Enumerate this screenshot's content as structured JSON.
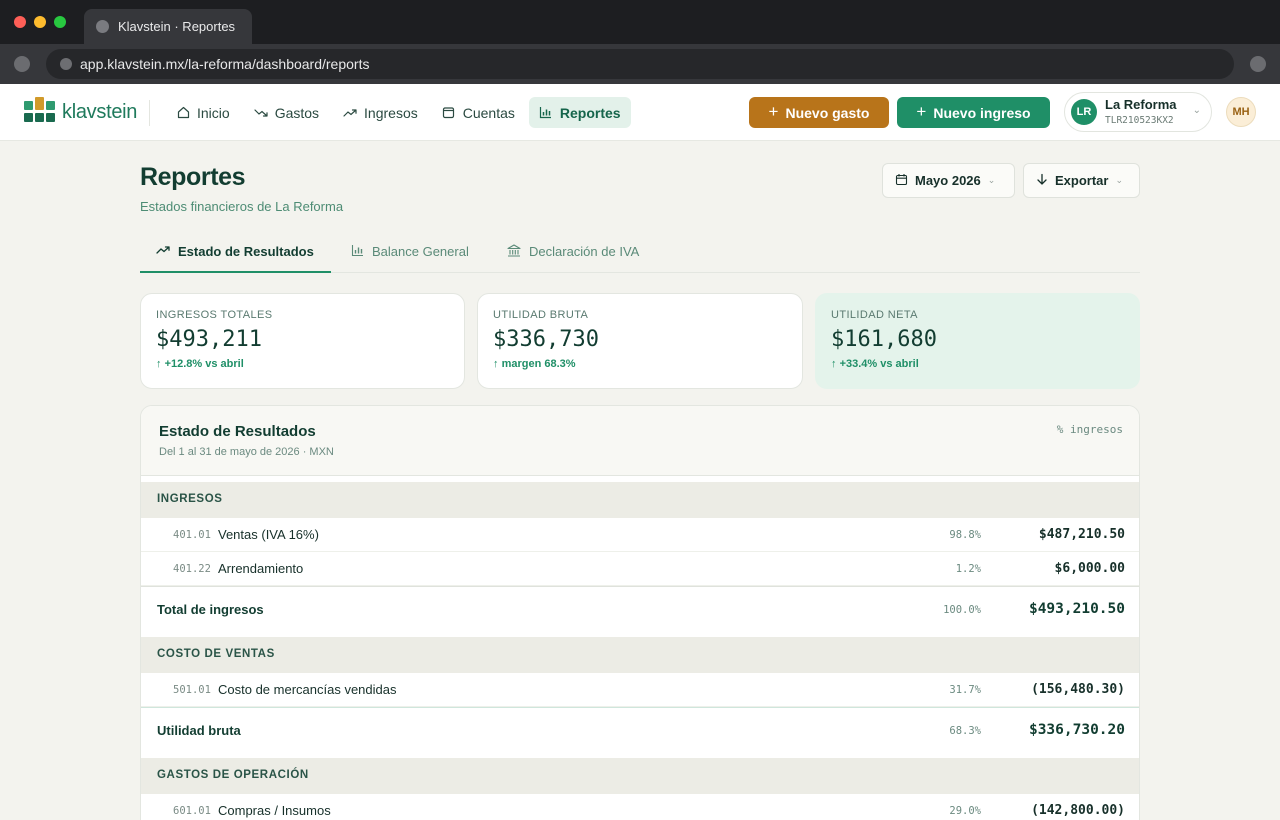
{
  "browser": {
    "tab_title": "Klavstein · Reportes",
    "url": "app.klavstein.mx/la-reforma/dashboard/reports"
  },
  "app": {
    "logo_text": "klavstein",
    "nav": [
      {
        "label": "Inicio",
        "icon": "home-icon"
      },
      {
        "label": "Gastos",
        "icon": "trend-down-icon"
      },
      {
        "label": "Ingresos",
        "icon": "trend-up-icon"
      },
      {
        "label": "Cuentas",
        "icon": "wallet-icon"
      },
      {
        "label": "Reportes",
        "icon": "bar-chart-icon",
        "active": true
      }
    ],
    "new_expense": "Nuevo gasto",
    "new_income": "Nuevo ingreso",
    "org": {
      "initials": "LR",
      "name": "La Reforma",
      "rfc": "TLR210523KX2"
    },
    "user_initials": "MH"
  },
  "page": {
    "title": "Reportes",
    "subtitle": "Estados financieros de La Reforma",
    "period": "Mayo 2026",
    "export": "Exportar"
  },
  "tabs": [
    {
      "label": "Estado de Resultados",
      "active": true
    },
    {
      "label": "Balance General"
    },
    {
      "label": "Declaración de IVA"
    }
  ],
  "kpis": [
    {
      "label": "INGRESOS TOTALES",
      "value": "$493,211",
      "delta": "+12.8% vs abril"
    },
    {
      "label": "UTILIDAD BRUTA",
      "value": "$336,730",
      "delta": "margen 68.3%"
    },
    {
      "label": "UTILIDAD NETA",
      "value": "$161,680",
      "delta": "+33.4% vs abril"
    }
  ],
  "statement": {
    "title": "Estado de Resultados",
    "subtitle": "Del 1 al 31 de mayo de 2026 · MXN",
    "pct_header": "% ingresos",
    "sec_ingresos": "INGRESOS",
    "row_ventas": {
      "code": "401.01",
      "name": "Ventas (IVA 16%)",
      "pct": "98.8%",
      "amount": "$487,210.50"
    },
    "row_arrend": {
      "code": "401.22",
      "name": "Arrendamiento",
      "pct": "1.2%",
      "amount": "$6,000.00"
    },
    "total_ingresos": {
      "label": "Total de ingresos",
      "pct": "100.0%",
      "amount": "$493,210.50"
    },
    "sec_costo": "COSTO DE VENTAS",
    "row_costo": {
      "code": "501.01",
      "name": "Costo de mercancías vendidas",
      "pct": "31.7%",
      "amount": "(156,480.30)"
    },
    "utilidad_bruta": {
      "label": "Utilidad bruta",
      "pct": "68.3%",
      "amount": "$336,730.20"
    },
    "sec_gastos": "GASTOS DE OPERACIÓN",
    "row_compras": {
      "code": "601.01",
      "name": "Compras / Insumos",
      "pct": "29.0%",
      "amount": "(142,800.00)"
    }
  },
  "colors": {
    "primary_green": "#1f8f67",
    "expense_amber": "#b8741a",
    "highlight_card": "#e4f3eb"
  }
}
